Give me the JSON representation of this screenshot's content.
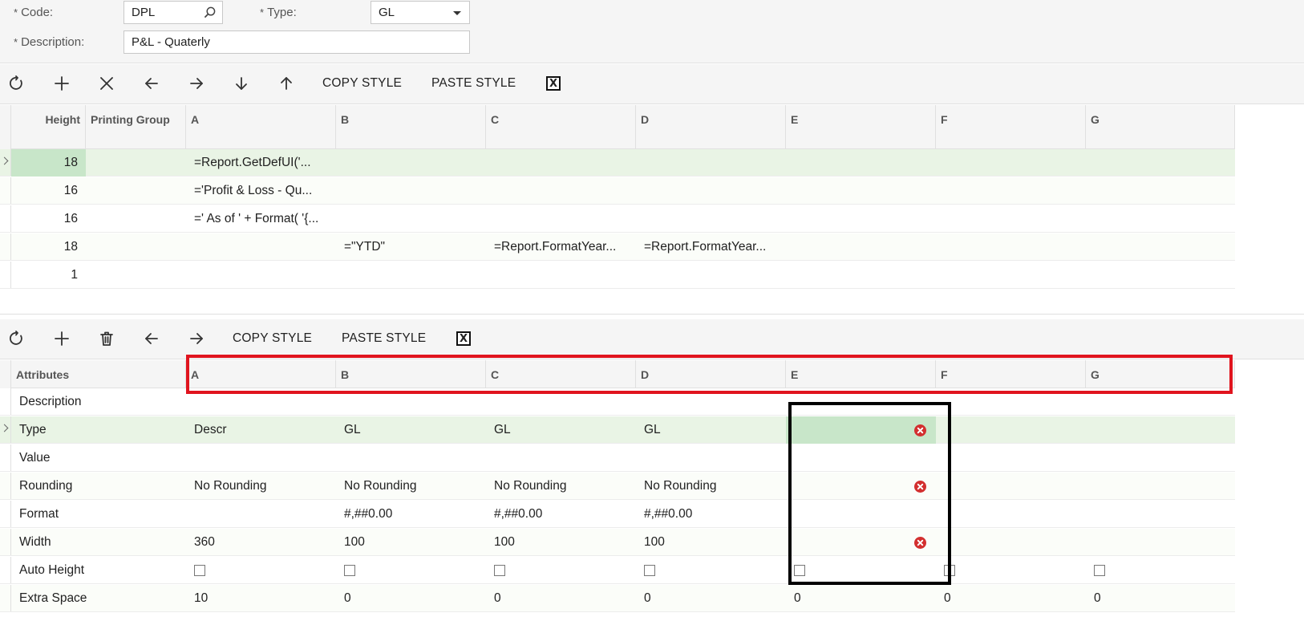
{
  "form": {
    "code_label": "Code:",
    "code_value": "DPL",
    "type_label": "Type:",
    "type_value": "GL",
    "description_label": "Description:",
    "description_value": "P&L - Quaterly",
    "required_mark": "*"
  },
  "rows_toolbar": {
    "copy_style": "COPY STYLE",
    "paste_style": "PASTE STYLE"
  },
  "rows_grid": {
    "headers": [
      "Height",
      "Printing Group",
      "A",
      "B",
      "C",
      "D",
      "E",
      "F",
      "G"
    ],
    "rows": [
      {
        "height": "18",
        "group": "",
        "a": "=Report.GetDefUI('...",
        "b": "",
        "c": "",
        "d": ""
      },
      {
        "height": "16",
        "group": "",
        "a": "='Profit & Loss - Qu...",
        "b": "",
        "c": "",
        "d": ""
      },
      {
        "height": "16",
        "group": "",
        "a": "=' As of ' + Format( '{...",
        "b": "",
        "c": "",
        "d": ""
      },
      {
        "height": "18",
        "group": "",
        "a": "",
        "b": "=\"YTD\"",
        "c": "=Report.FormatYear...",
        "d": "=Report.FormatYear..."
      },
      {
        "height": "1",
        "group": "",
        "a": "",
        "b": "",
        "c": "",
        "d": ""
      }
    ]
  },
  "columns_toolbar": {
    "copy_style": "COPY STYLE",
    "paste_style": "PASTE STYLE"
  },
  "columns_grid": {
    "headers": [
      "Attributes",
      "A",
      "B",
      "C",
      "D",
      "E",
      "F",
      "G"
    ],
    "rows": [
      {
        "attr": "Description",
        "a": "",
        "b": "",
        "c": "",
        "d": "",
        "e": "",
        "f": "",
        "g": ""
      },
      {
        "attr": "Type",
        "a": "Descr",
        "b": "GL",
        "c": "GL",
        "d": "GL",
        "e": "",
        "f": "",
        "g": ""
      },
      {
        "attr": "Value",
        "a": "",
        "b": "",
        "c": "",
        "d": "",
        "e": "",
        "f": "",
        "g": ""
      },
      {
        "attr": "Rounding",
        "a": "No Rounding",
        "b": "No Rounding",
        "c": "No Rounding",
        "d": "No Rounding",
        "e": "",
        "f": "",
        "g": ""
      },
      {
        "attr": "Format",
        "a": "",
        "b": "#,##0.00",
        "c": "#,##0.00",
        "d": "#,##0.00",
        "e": "",
        "f": "",
        "g": ""
      },
      {
        "attr": "Width",
        "a": "360",
        "b": "100",
        "c": "100",
        "d": "100",
        "e": "",
        "f": "",
        "g": ""
      },
      {
        "attr": "Auto Height",
        "a": "",
        "b": "",
        "c": "",
        "d": "",
        "e": "",
        "f": "",
        "g": ""
      },
      {
        "attr": "Extra Space",
        "a": "10",
        "b": "0",
        "c": "0",
        "d": "0",
        "e": "0",
        "f": "0",
        "g": "0"
      }
    ]
  },
  "colors": {
    "selected_row": "#e9f4e5",
    "selected_cell": "#c8e6c9",
    "error": "#d32f2f",
    "highlight_red": "#e0141e"
  }
}
